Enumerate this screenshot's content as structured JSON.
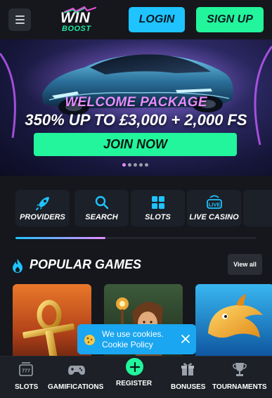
{
  "header": {
    "logo_text": "WIN",
    "logo_sub": "BOOST",
    "login_label": "LOGIN",
    "signup_label": "SIGN UP"
  },
  "banner": {
    "title": "WELCOME PACKAGE",
    "subtitle": "350% UP TO £3,000 + 2,000 FS",
    "cta_label": "JOIN NOW",
    "slide_count": 5,
    "active_slide": 1
  },
  "categories": [
    {
      "label": "PROVIDERS",
      "icon": "rocket-icon"
    },
    {
      "label": "SEARCH",
      "icon": "search-icon"
    },
    {
      "label": "SLOTS",
      "icon": "grid-icon"
    },
    {
      "label": "LIVE CASINO",
      "icon": "live-icon"
    }
  ],
  "popular": {
    "title": "POPULAR GAMES",
    "view_all_label": "View all"
  },
  "cookie": {
    "text": "We use cookies.",
    "link": "Cookie Policy"
  },
  "bottom_nav": [
    {
      "label": "SLOTS",
      "icon": "slot-machine-icon"
    },
    {
      "label": "GAMIFICATIONS",
      "icon": "gamepad-icon"
    },
    {
      "label": "REGISTER",
      "icon": "plus-icon"
    },
    {
      "label": "BONUSES",
      "icon": "gift-icon"
    },
    {
      "label": "TOURNAMENTS",
      "icon": "trophy-icon"
    }
  ],
  "colors": {
    "background": "#15171c",
    "accent_green": "#22f59b",
    "accent_blue": "#1ec3ff",
    "accent_pink": "#e58cff",
    "cookie_blue": "#1aa6f0"
  }
}
